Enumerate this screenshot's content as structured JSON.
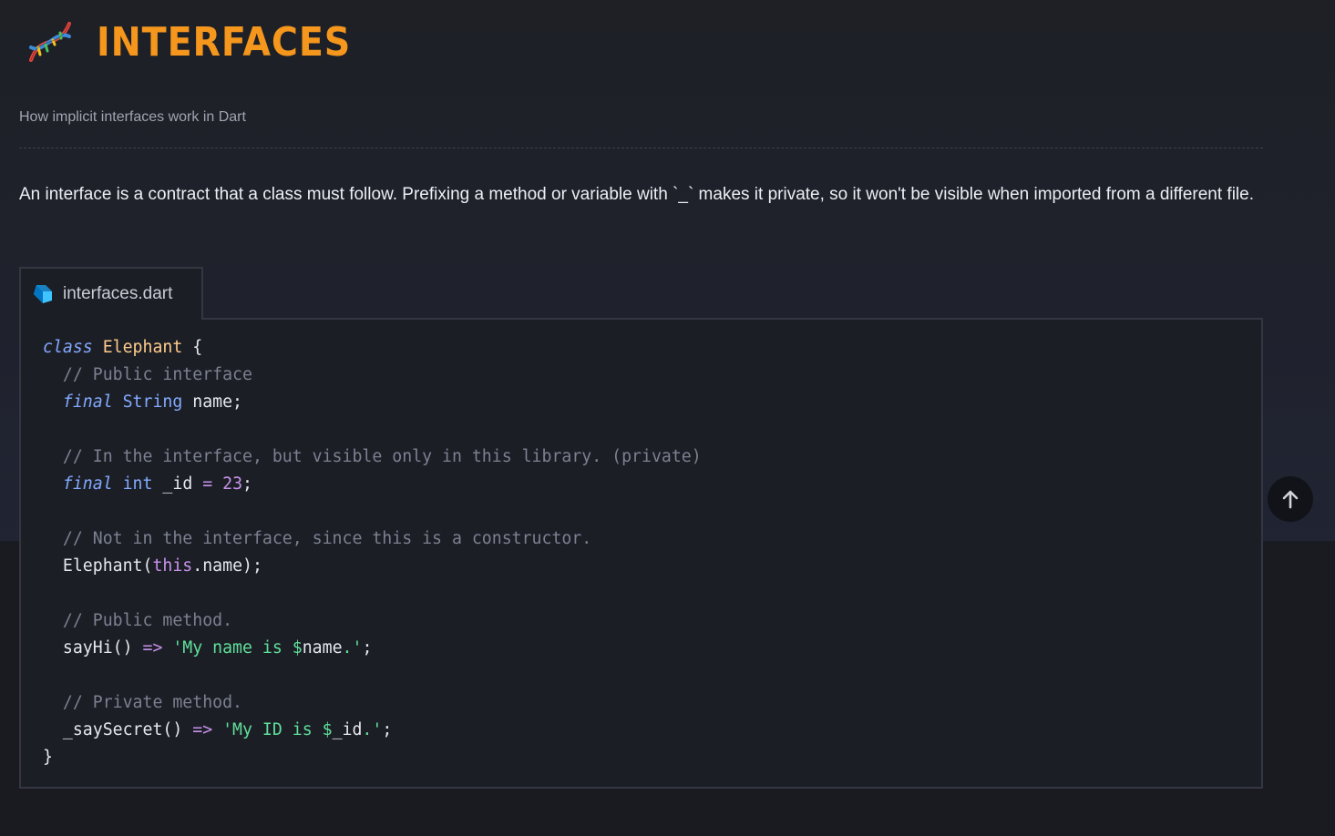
{
  "header": {
    "title": "INTERFACES",
    "logo_icon": "dna-icon",
    "accent_color": "#f5961d"
  },
  "subtitle": "How implicit interfaces work in Dart",
  "description": "An interface is a contract that a class must follow. Prefixing a method or variable with `_` makes it private, so it won't be visible when imported from a different file.",
  "code_block": {
    "filename": "interfaces.dart",
    "file_icon": "dart-logo-icon",
    "lines": [
      [
        {
          "t": "class",
          "c": "kw-class"
        },
        {
          "t": " ",
          "c": "plain"
        },
        {
          "t": "Elephant",
          "c": "cls"
        },
        {
          "t": " {",
          "c": "plain"
        }
      ],
      [
        {
          "t": "  // Public interface",
          "c": "cm"
        }
      ],
      [
        {
          "t": "  ",
          "c": "plain"
        },
        {
          "t": "final",
          "c": "kw-final"
        },
        {
          "t": " ",
          "c": "plain"
        },
        {
          "t": "String",
          "c": "type"
        },
        {
          "t": " name;",
          "c": "plain"
        }
      ],
      [],
      [
        {
          "t": "  // In the interface, but visible only in this library. (private)",
          "c": "cm"
        }
      ],
      [
        {
          "t": "  ",
          "c": "plain"
        },
        {
          "t": "final",
          "c": "kw-final"
        },
        {
          "t": " ",
          "c": "plain"
        },
        {
          "t": "int",
          "c": "type"
        },
        {
          "t": " _id ",
          "c": "plain"
        },
        {
          "t": "=",
          "c": "op"
        },
        {
          "t": " ",
          "c": "plain"
        },
        {
          "t": "23",
          "c": "num"
        },
        {
          "t": ";",
          "c": "plain"
        }
      ],
      [],
      [
        {
          "t": "  // Not in the interface, since this is a constructor.",
          "c": "cm"
        }
      ],
      [
        {
          "t": "  Elephant(",
          "c": "plain"
        },
        {
          "t": "this",
          "c": "this"
        },
        {
          "t": ".name);",
          "c": "plain"
        }
      ],
      [],
      [
        {
          "t": "  // Public method.",
          "c": "cm"
        }
      ],
      [
        {
          "t": "  sayHi() ",
          "c": "plain"
        },
        {
          "t": "=>",
          "c": "op"
        },
        {
          "t": " ",
          "c": "plain"
        },
        {
          "t": "'My name is ",
          "c": "str"
        },
        {
          "t": "$",
          "c": "str"
        },
        {
          "t": "name",
          "c": "plain"
        },
        {
          "t": ".'",
          "c": "str"
        },
        {
          "t": ";",
          "c": "plain"
        }
      ],
      [],
      [
        {
          "t": "  // Private method.",
          "c": "cm"
        }
      ],
      [
        {
          "t": "  _saySecret() ",
          "c": "plain"
        },
        {
          "t": "=>",
          "c": "op"
        },
        {
          "t": " ",
          "c": "plain"
        },
        {
          "t": "'My ID is ",
          "c": "str"
        },
        {
          "t": "$",
          "c": "str"
        },
        {
          "t": "_id",
          "c": "plain"
        },
        {
          "t": ".'",
          "c": "str"
        },
        {
          "t": ";",
          "c": "plain"
        }
      ],
      [
        {
          "t": "}",
          "c": "plain"
        }
      ]
    ]
  },
  "scroll_top_button": {
    "icon": "arrow-up-icon"
  }
}
